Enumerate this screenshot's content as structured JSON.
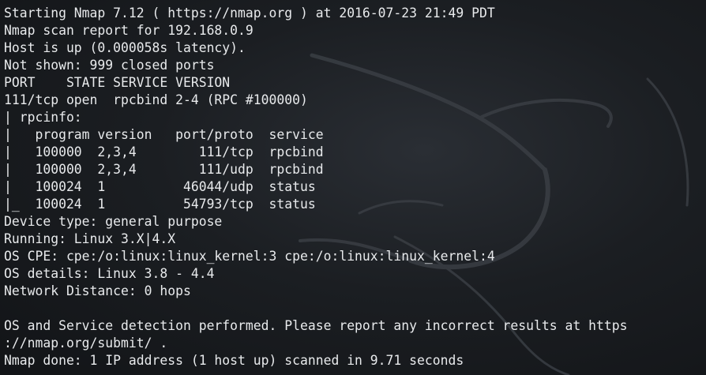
{
  "terminal": {
    "lines": [
      "Starting Nmap 7.12 ( https://nmap.org ) at 2016-07-23 21:49 PDT",
      "Nmap scan report for 192.168.0.9",
      "Host is up (0.000058s latency).",
      "Not shown: 999 closed ports",
      "PORT    STATE SERVICE VERSION",
      "111/tcp open  rpcbind 2-4 (RPC #100000)",
      "| rpcinfo:",
      "|   program version   port/proto  service",
      "|   100000  2,3,4        111/tcp  rpcbind",
      "|   100000  2,3,4        111/udp  rpcbind",
      "|   100024  1          46044/udp  status",
      "|_  100024  1          54793/tcp  status",
      "Device type: general purpose",
      "Running: Linux 3.X|4.X",
      "OS CPE: cpe:/o:linux:linux_kernel:3 cpe:/o:linux:linux_kernel:4",
      "OS details: Linux 3.8 - 4.4",
      "Network Distance: 0 hops",
      "",
      "OS and Service detection performed. Please report any incorrect results at https",
      "://nmap.org/submit/ .",
      "Nmap done: 1 IP address (1 host up) scanned in 9.71 seconds"
    ]
  },
  "colors": {
    "background": "#1b1e22",
    "text": "#e8eaec",
    "watermark": "#3a3e44"
  },
  "watermark_icon": "kali-dragon-icon"
}
